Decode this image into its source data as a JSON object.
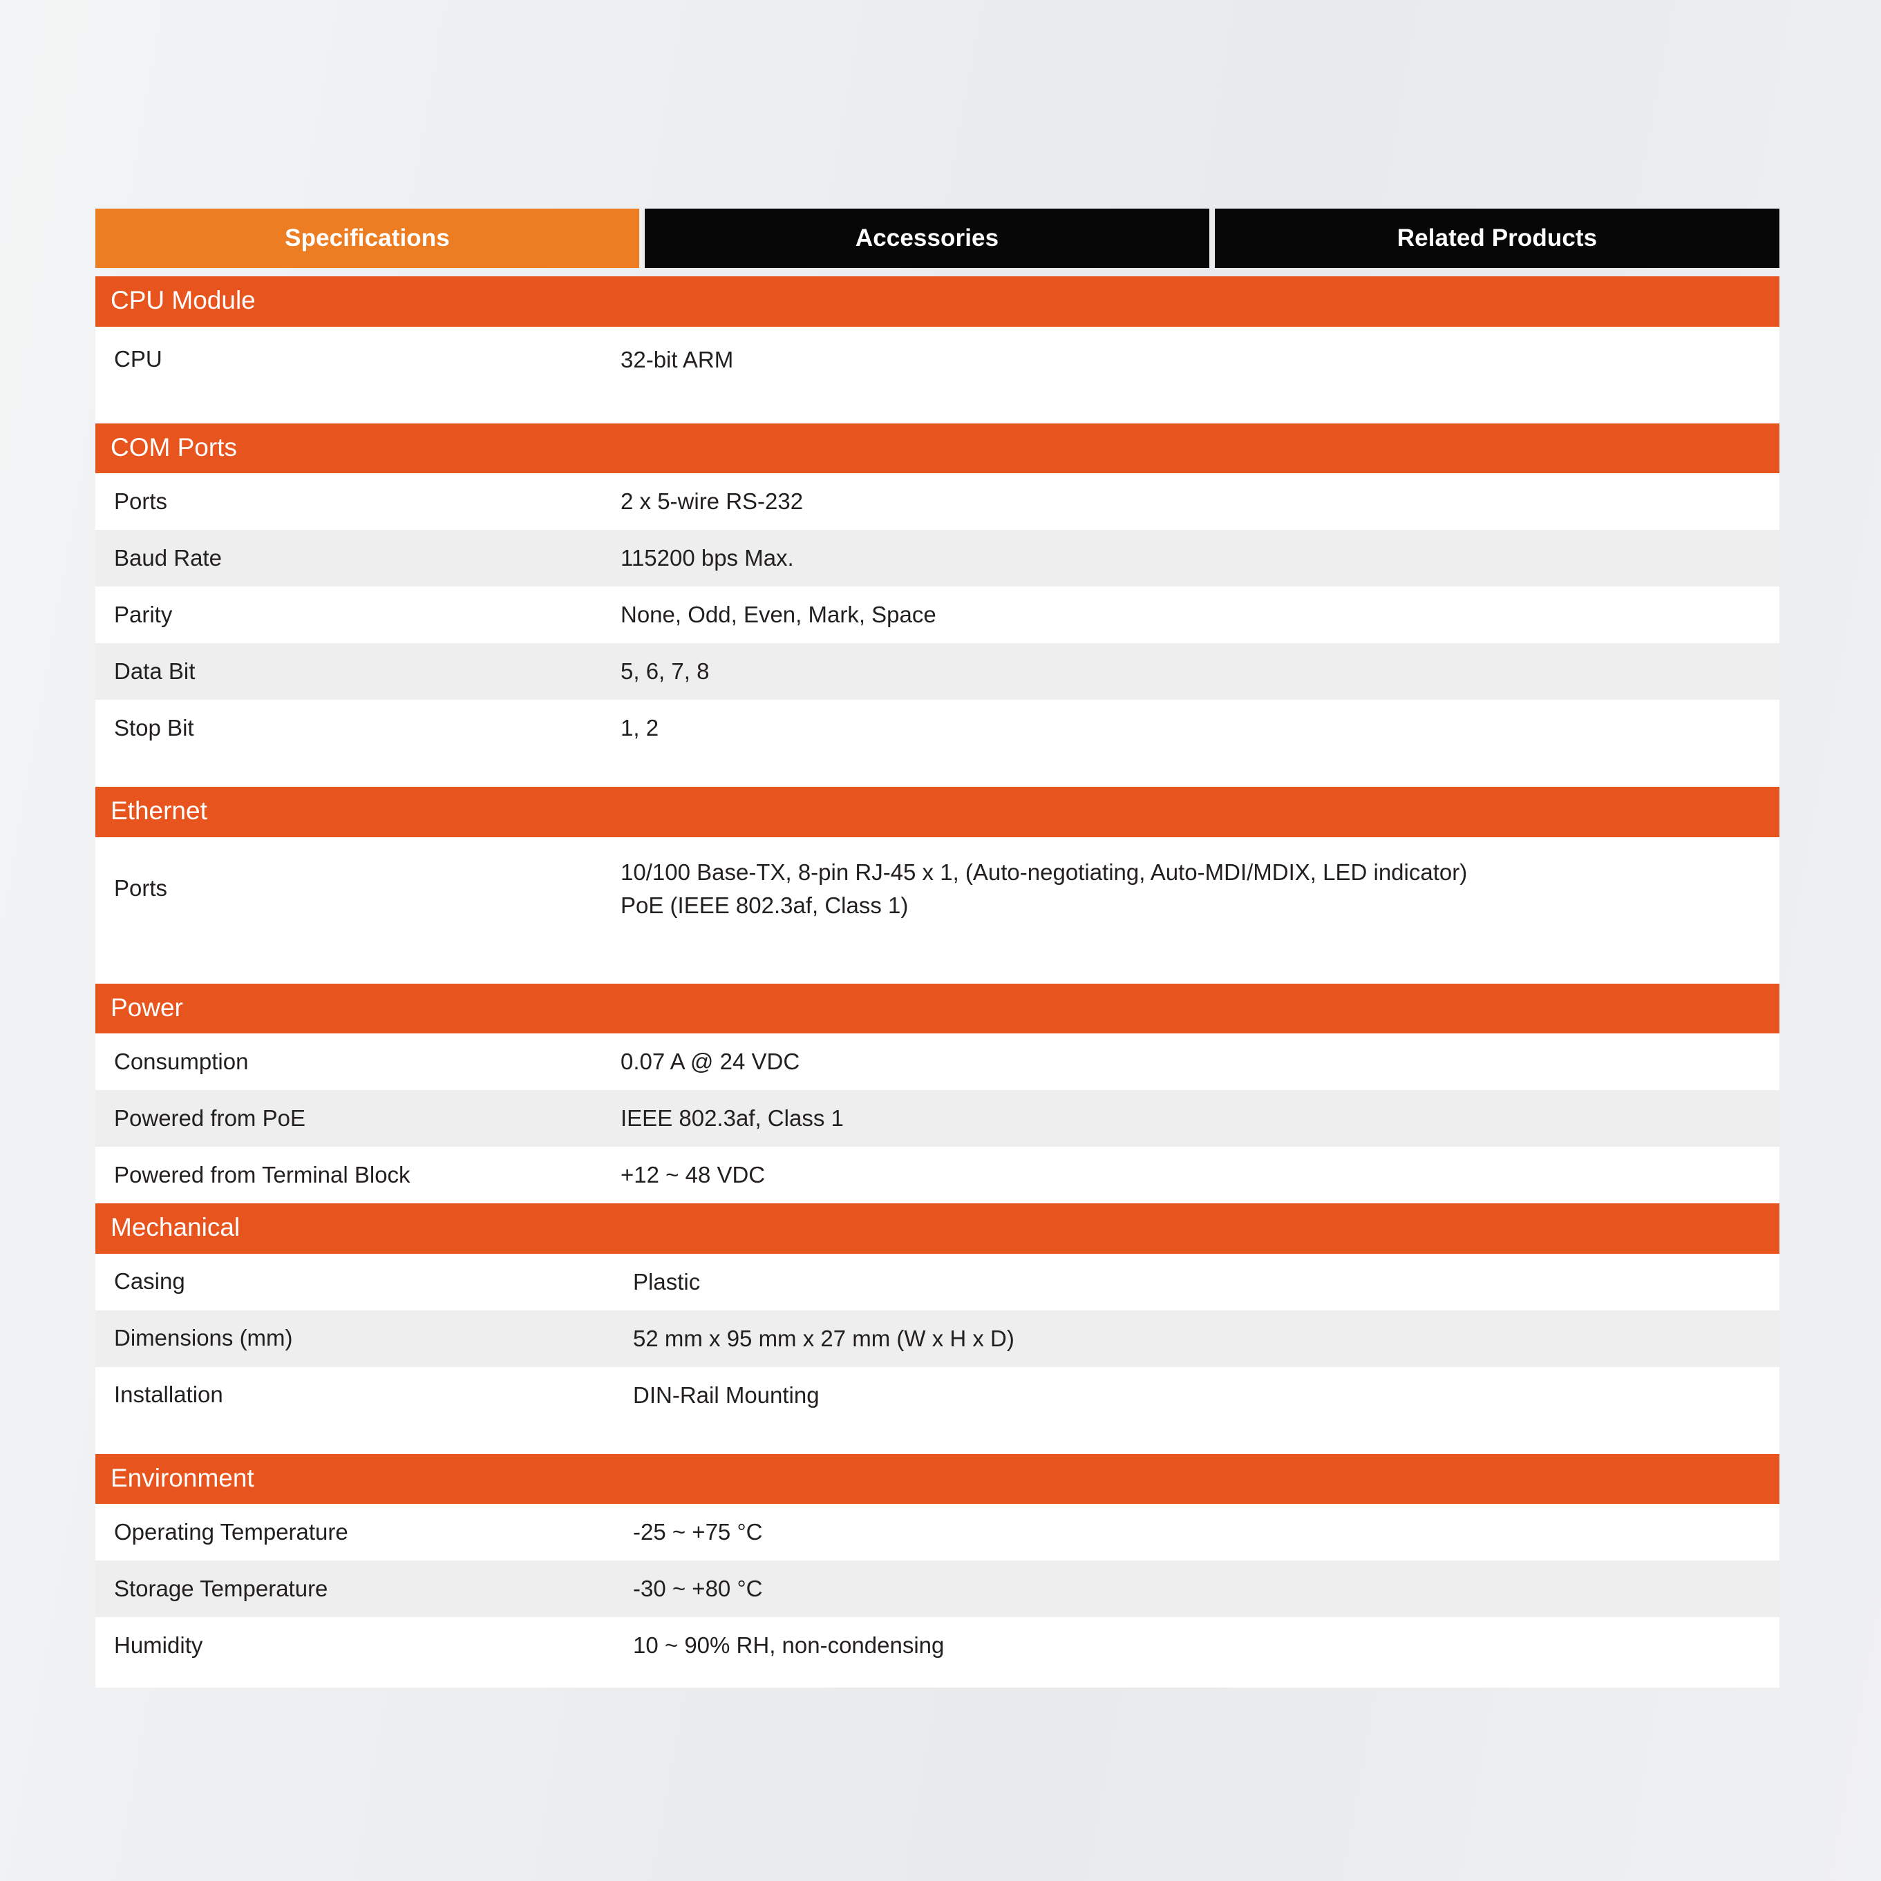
{
  "theme": {
    "active_tab_color": "#ED7D22",
    "inactive_tab_color": "#070707",
    "section_header_color": "#E8541E",
    "page_background": "#ECEDEF",
    "row_shaded_color": "#EEEEEE",
    "text_color": "#231F20"
  },
  "tabs": [
    {
      "label": "Specifications",
      "active": true
    },
    {
      "label": "Accessories",
      "active": false
    },
    {
      "label": "Related Products",
      "active": false
    }
  ],
  "sections": [
    {
      "title": "CPU Module",
      "rows": [
        {
          "label": "CPU",
          "value": "32-bit ARM"
        }
      ]
    },
    {
      "title": "COM Ports",
      "rows": [
        {
          "label": "Ports",
          "value": "2 x 5-wire RS-232"
        },
        {
          "label": "Baud Rate",
          "value": "115200 bps Max."
        },
        {
          "label": "Parity",
          "value": "None, Odd, Even, Mark, Space"
        },
        {
          "label": "Data Bit",
          "value": "5, 6, 7, 8"
        },
        {
          "label": "Stop Bit",
          "value": "1, 2"
        }
      ]
    },
    {
      "title": "Ethernet",
      "rows": [
        {
          "label": "Ports",
          "value": "10/100 Base-TX, 8-pin RJ-45 x 1, (Auto-negotiating, Auto-MDI/MDIX, LED indicator)\nPoE (IEEE 802.3af, Class 1)"
        }
      ]
    },
    {
      "title": "Power",
      "rows": [
        {
          "label": "Consumption",
          "value": "0.07 A @ 24 VDC"
        },
        {
          "label": "Powered from PoE",
          "value": "IEEE 802.3af, Class 1"
        },
        {
          "label": "Powered from Terminal Block",
          "value": "+12 ~ 48 VDC"
        }
      ]
    },
    {
      "title": "Mechanical",
      "rows": [
        {
          "label": "Casing",
          "value": "Plastic"
        },
        {
          "label": "Dimensions (mm)",
          "value": "52 mm x 95 mm x 27 mm (W x H x D)"
        },
        {
          "label": "Installation",
          "value": "DIN-Rail Mounting"
        }
      ]
    },
    {
      "title": "Environment",
      "rows": [
        {
          "label": "Operating Temperature",
          "value": "-25 ~ +75 °C"
        },
        {
          "label": "Storage Temperature",
          "value": "-30 ~ +80 °C"
        },
        {
          "label": "Humidity",
          "value": "10 ~ 90% RH, non-condensing"
        }
      ]
    }
  ]
}
